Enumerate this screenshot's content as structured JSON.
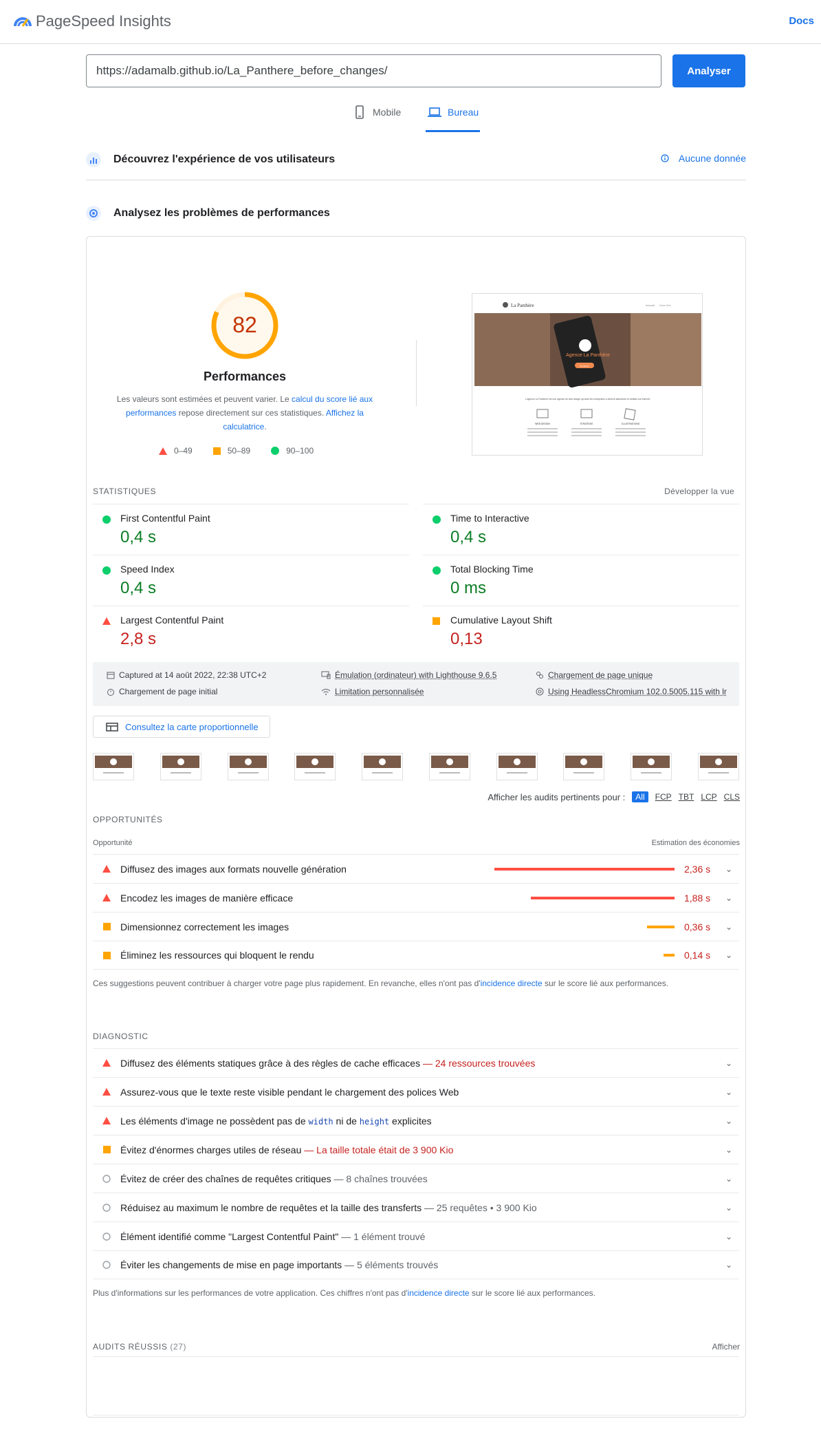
{
  "header": {
    "brand": "PageSpeed Insights",
    "docs": "Docs"
  },
  "search": {
    "url": "https://adamalb.github.io/La_Panthere_before_changes/",
    "button": "Analyser"
  },
  "tabs": [
    {
      "label": "Mobile"
    },
    {
      "label": "Bureau"
    }
  ],
  "field": {
    "title": "Découvrez l'expérience de vos utilisateurs",
    "nodata": "Aucune donnée"
  },
  "lab": {
    "title": "Analysez les problèmes de performances"
  },
  "score": {
    "value": "82",
    "fraction": 0.82,
    "label": "Performances",
    "desc_1": "Les valeurs sont estimées et peuvent varier. Le ",
    "desc_link_1": "calcul du score lié aux performances",
    "desc_2": " repose directement sur ces statistiques. ",
    "desc_link_2": "Affichez la calculatrice",
    "desc_3": ".",
    "legend": [
      "0–49",
      "50–89",
      "90–100"
    ]
  },
  "screenshot": {
    "site_name": "La Panthère",
    "nav": [
      "Accueil",
      "Livre d'or"
    ],
    "hero_text": "Agence La Panthère",
    "hero_button": "Contactez",
    "intro": "L'agence La Panthère est une agence de web design qui aide les entreprises à devenir attractives et visibles sur Internet.",
    "features": [
      "WEB DESIGN",
      "STRATÉGIE",
      "ILLUSTRATIONS"
    ]
  },
  "metrics": {
    "title": "STATISTIQUES",
    "expand": "Développer la vue",
    "items": [
      {
        "name": "First Contentful Paint",
        "value": "0,4 s",
        "status": "pass"
      },
      {
        "name": "Time to Interactive",
        "value": "0,4 s",
        "status": "pass"
      },
      {
        "name": "Speed Index",
        "value": "0,4 s",
        "status": "pass"
      },
      {
        "name": "Total Blocking Time",
        "value": "0 ms",
        "status": "pass"
      },
      {
        "name": "Largest Contentful Paint",
        "value": "2,8 s",
        "status": "fail"
      },
      {
        "name": "Cumulative Layout Shift",
        "value": "0,13",
        "status": "average"
      }
    ]
  },
  "env": {
    "captured": "Captured at 14 août 2022, 22:38 UTC+2",
    "emulation": "Émulation (ordinateur) with Lighthouse 9.6.5",
    "single": "Chargement de page unique",
    "initial": "Chargement de page initial",
    "throttle": "Limitation personnalisée",
    "browser": "Using HeadlessChromium 102.0.5005.115 with lr"
  },
  "treemap": "Consultez la carte proportionnelle",
  "filmstrip_count": 10,
  "filters": {
    "label": "Afficher les audits pertinents pour :",
    "options": [
      "All",
      "FCP",
      "TBT",
      "LCP",
      "CLS"
    ]
  },
  "opportunities": {
    "title": "OPPORTUNITÉS",
    "col1": "Opportunité",
    "col2": "Estimation des économies",
    "items": [
      {
        "label": "Diffusez des images aux formats nouvelle génération",
        "saving": "2,36 s",
        "seconds": 2.36,
        "status": "fail"
      },
      {
        "label": "Encodez les images de manière efficace",
        "saving": "1,88 s",
        "seconds": 1.88,
        "status": "fail"
      },
      {
        "label": "Dimensionnez correctement les images",
        "saving": "0,36 s",
        "seconds": 0.36,
        "status": "average"
      },
      {
        "label": "Éliminez les ressources qui bloquent le rendu",
        "saving": "0,14 s",
        "seconds": 0.14,
        "status": "average"
      }
    ],
    "note_1": "Ces suggestions peuvent contribuer à charger votre page plus rapidement. En revanche, elles n'ont pas d'",
    "note_link": "incidence directe",
    "note_2": " sur le score lié aux performances."
  },
  "diagnostics": {
    "title": "DIAGNOSTIC",
    "items": [
      {
        "label": "Diffusez des éléments statiques grâce à des règles de cache efficaces",
        "sub": "— 24 ressources trouvées",
        "status": "fail"
      },
      {
        "label": "Assurez-vous que le texte reste visible pendant le chargement des polices Web",
        "sub": "",
        "status": "fail"
      },
      {
        "label_a": "Les éléments d'image ne possèdent pas de ",
        "code_a": "width",
        "label_b": " ni de ",
        "code_b": "height",
        "label_c": " explicites",
        "status": "fail"
      },
      {
        "label": "Évitez d'énormes charges utiles de réseau",
        "sub": "— La taille totale était de 3 900 Kio",
        "status": "average"
      },
      {
        "label": "Évitez de créer des chaînes de requêtes critiques",
        "sub": "— 8 chaînes trouvées",
        "status": "info"
      },
      {
        "label": "Réduisez au maximum le nombre de requêtes et la taille des transferts",
        "sub": "— 25 requêtes • 3 900 Kio",
        "status": "info"
      },
      {
        "label": "Élément identifié comme \"Largest Contentful Paint\"",
        "sub": "— 1 élément trouvé",
        "status": "info"
      },
      {
        "label": "Éviter les changements de mise en page importants",
        "sub": "— 5 éléments trouvés",
        "status": "info"
      }
    ],
    "note_1": "Plus d'informations sur les performances de votre application. Ces chiffres n'ont pas d'",
    "note_link": "incidence directe",
    "note_2": " sur le score lié aux performances."
  },
  "passed": {
    "title": "AUDITS RÉUSSIS",
    "count": "(27)",
    "show": "Afficher"
  },
  "colors": {
    "accent": "#1a73e8",
    "pass": "#0cce6b",
    "average": "#ffa400",
    "fail": "#ff4e42"
  }
}
